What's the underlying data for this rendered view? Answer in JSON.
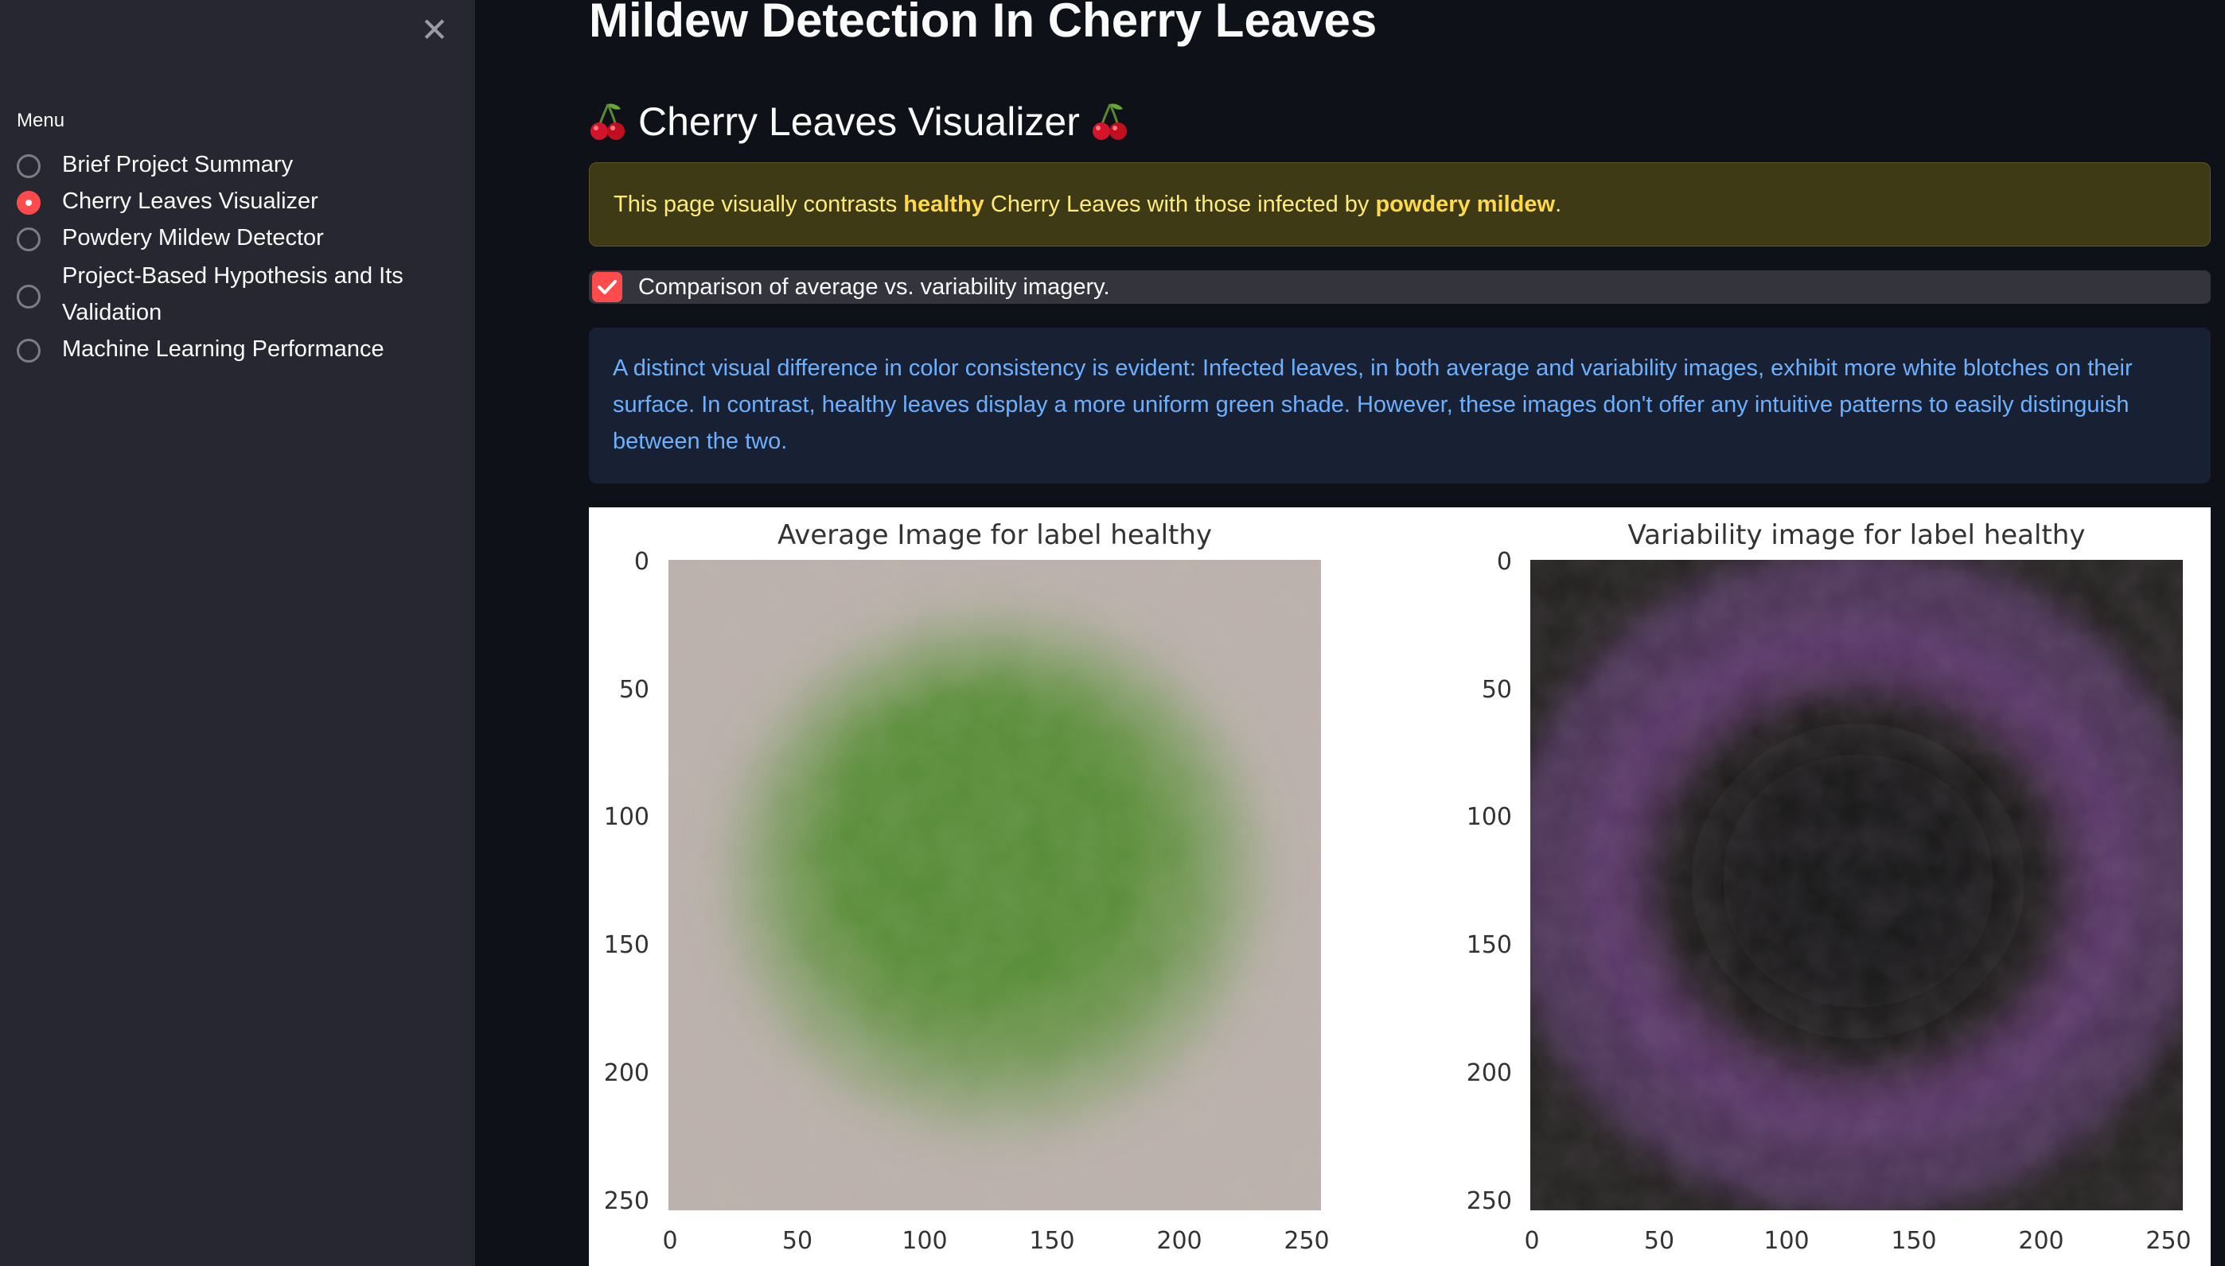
{
  "sidebar": {
    "close_icon": "close-icon",
    "menu_label": "Menu",
    "items": [
      {
        "label": "Brief Project Summary",
        "selected": false
      },
      {
        "label": "Cherry Leaves Visualizer",
        "selected": true
      },
      {
        "label": "Powdery Mildew Detector",
        "selected": false
      },
      {
        "label": "Project-Based Hypothesis and Its Validation",
        "selected": false
      },
      {
        "label": "Machine Learning Performance",
        "selected": false
      }
    ]
  },
  "main": {
    "title": "Mildew Detection In Cherry Leaves",
    "subheader": "Cherry Leaves Visualizer",
    "subheader_icon": "cherry-icon",
    "warning": {
      "prefix": "This page visually contrasts ",
      "bold1": "healthy",
      "middle": " Cherry Leaves with those infected by ",
      "bold2": "powdery mildew",
      "suffix": "."
    },
    "checkbox": {
      "label": "Comparison of average vs. variability imagery.",
      "checked": true
    },
    "info": "A distinct visual difference in color consistency is evident: Infected leaves, in both average and variability images, exhibit more white blotches on their surface. In contrast, healthy leaves display a more uniform green shade. However, these images don't offer any intuitive patterns to easily distinguish between the two."
  },
  "colors": {
    "accent": "#ff4b4b",
    "sidebar_bg": "#262730",
    "main_bg": "#0e1117",
    "warning_bg": "#3d3a15",
    "warning_text": "#ffeb7a",
    "info_bg": "#172133",
    "info_text": "#6cb0ff"
  },
  "figure": {
    "panels": [
      {
        "title": "Average Image for label healthy",
        "x_ticks": [
          "0",
          "50",
          "100",
          "150",
          "200",
          "250"
        ],
        "y_ticks": [
          "0",
          "50",
          "100",
          "150",
          "200",
          "250"
        ],
        "palette": "green leaf on grey"
      },
      {
        "title": "Variability image for label healthy",
        "x_ticks": [
          "0",
          "50",
          "100",
          "150",
          "200",
          "250"
        ],
        "y_ticks": [
          "0",
          "50",
          "100",
          "150",
          "200",
          "250"
        ],
        "palette": "purple ring on dark"
      }
    ]
  }
}
